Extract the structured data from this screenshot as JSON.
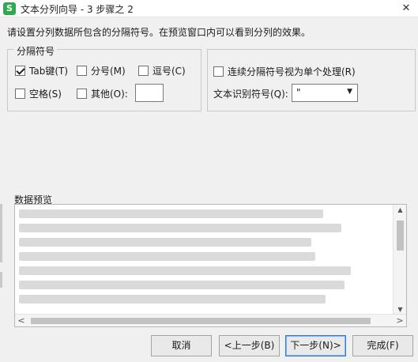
{
  "window": {
    "icon_letter": "S",
    "title": "文本分列向导 - 3 步骤之 2",
    "close_glyph": "✕"
  },
  "instruction": "请设置分列数据所包含的分隔符号。在预览窗口内可以看到分列的效果。",
  "delimiters": {
    "legend": "分隔符号",
    "tab": {
      "label": "Tab键(T)",
      "checked": true
    },
    "semicolon": {
      "label": "分号(M)",
      "checked": false
    },
    "comma": {
      "label": "逗号(C)",
      "checked": false
    },
    "space": {
      "label": "空格(S)",
      "checked": false
    },
    "other": {
      "label": "其他(O):",
      "checked": false,
      "value": ""
    }
  },
  "options": {
    "consecutive": {
      "label": "连续分隔符号视为单个处理(R)",
      "checked": false
    },
    "text_qualifier_label": "文本识别符号(Q):",
    "text_qualifier_value": "\"",
    "dropdown_glyph": "▼"
  },
  "preview": {
    "label": "数据预览",
    "scroll_up": "▲",
    "scroll_down": "▼",
    "scroll_left": "<",
    "scroll_right": ">"
  },
  "buttons": {
    "cancel": "取消",
    "back": "<上一步(B)",
    "next": "下一步(N)>",
    "finish": "完成(F)"
  },
  "colors": {
    "app_icon": "#2eab4e",
    "primary_button_border": "#2f7ad8",
    "dialog_background": "#f0f0f0"
  }
}
